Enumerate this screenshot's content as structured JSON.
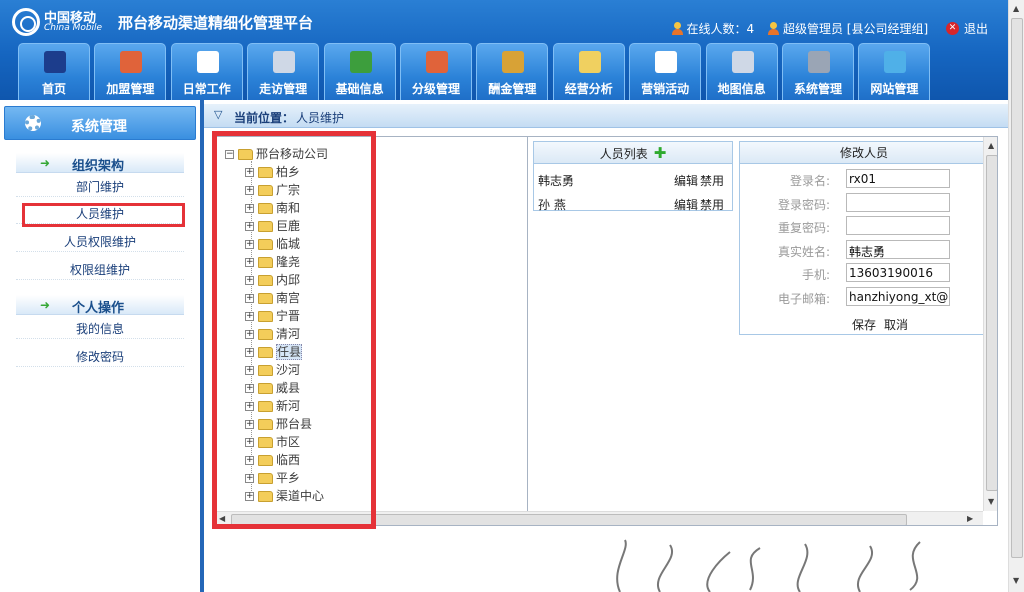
{
  "header": {
    "logo_cn": "中国移动",
    "logo_en": "China Mobile",
    "title": "邢台移动渠道精细化管理平台",
    "online_label": "在线人数：4",
    "user_label": "超级管理员 [县公司经理组]",
    "logout_label": "退出"
  },
  "nav": [
    {
      "label": "首页",
      "icon": "monitor-icon"
    },
    {
      "label": "加盟管理",
      "icon": "shop-icon"
    },
    {
      "label": "日常工作",
      "icon": "document-icon"
    },
    {
      "label": "走访管理",
      "icon": "satellite-icon"
    },
    {
      "label": "基础信息",
      "icon": "phone-icon"
    },
    {
      "label": "分级管理",
      "icon": "shop-icon"
    },
    {
      "label": "酬金管理",
      "icon": "money-icon"
    },
    {
      "label": "经营分析",
      "icon": "pencil-icon"
    },
    {
      "label": "营销活动",
      "icon": "document-icon"
    },
    {
      "label": "地图信息",
      "icon": "satellite-icon"
    },
    {
      "label": "系统管理",
      "icon": "gear-icon"
    },
    {
      "label": "网站管理",
      "icon": "globe-icon"
    }
  ],
  "sidebar": {
    "title": "系统管理",
    "sections": [
      {
        "title": "组织架构",
        "items": [
          "部门维护",
          "人员维护",
          "人员权限维护",
          "权限组维护"
        ]
      },
      {
        "title": "个人操作",
        "items": [
          "我的信息",
          "修改密码"
        ]
      }
    ]
  },
  "breadcrumb": {
    "label": "当前位置：",
    "value": "人员维护"
  },
  "tree": {
    "root": "邢台移动公司",
    "children": [
      "柏乡",
      "广宗",
      "南和",
      "巨鹿",
      "临城",
      "隆尧",
      "内邱",
      "南宫",
      "宁晋",
      "清河",
      "任县",
      "沙河",
      "威县",
      "新河",
      "邢台县",
      "市区",
      "临西",
      "平乡",
      "渠道中心"
    ],
    "selected": "任县"
  },
  "person_list": {
    "title": "人员列表",
    "edit_label": "编辑",
    "disable_label": "禁用",
    "rows": [
      "韩志勇",
      "孙 燕"
    ]
  },
  "edit_form": {
    "title": "修改人员",
    "fields": [
      {
        "label": "登录名:",
        "value": "rx01"
      },
      {
        "label": "登录密码:",
        "value": ""
      },
      {
        "label": "重复密码:",
        "value": ""
      },
      {
        "label": "真实姓名:",
        "value": "韩志勇"
      },
      {
        "label": "手机:",
        "value": "13603190016"
      },
      {
        "label": "电子邮箱:",
        "value": "hanzhiyong_xt@he"
      }
    ],
    "save_label": "保存",
    "cancel_label": "取消"
  },
  "colors": {
    "header_blue": "#1565c0",
    "highlight_red": "#e53238"
  }
}
